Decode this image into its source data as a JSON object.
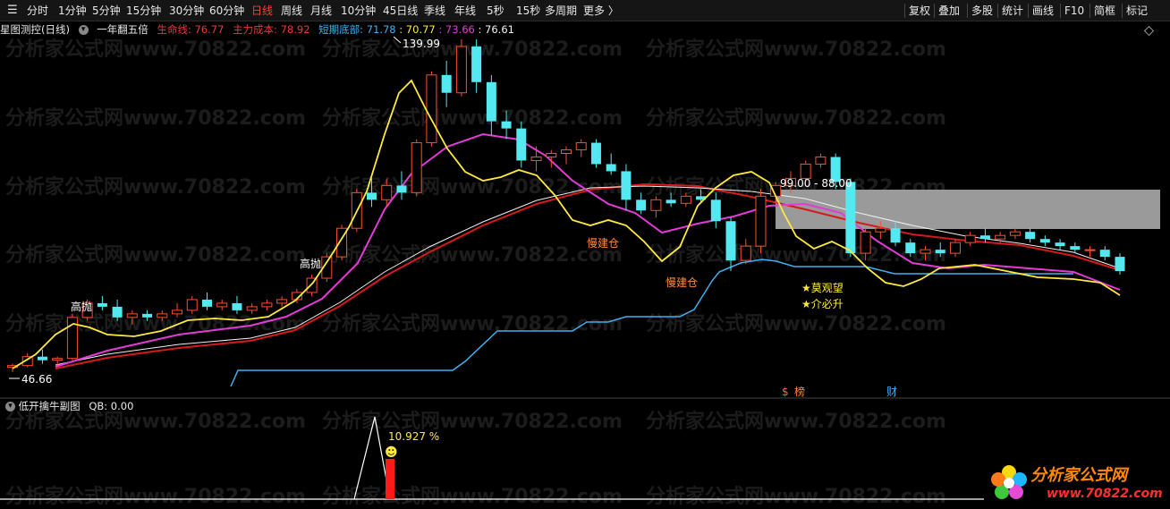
{
  "toolbar": {
    "periods": [
      "分时",
      "1分钟",
      "5分钟",
      "15分钟",
      "30分钟",
      "60分钟",
      "日线",
      "周线",
      "月线",
      "10分钟",
      "45日线",
      "季线",
      "年线",
      "5秒",
      "15秒",
      "多周期",
      "更多 〉"
    ],
    "active_period": "日线",
    "right_tools": [
      "复权",
      "叠加",
      "多股",
      "统计",
      "画线",
      "F10",
      "简框",
      "标记"
    ]
  },
  "legend": {
    "title": "星图测控(日线)",
    "formula": "一年翻五倍",
    "shengming_label": "生命线: 76.77",
    "zhuli_label": "主力成本: 78.92",
    "duanqi_label": "短期底部: 71.78",
    "v1": ": 70.77",
    "v2": ": 73.66",
    "v3": ": 76.61"
  },
  "annotations": {
    "high": "139.99",
    "low": "46.66",
    "range": "99.00 - 88.00",
    "gaopao1": "高抛",
    "gaopao2": "高抛",
    "jiancang1": "慢建仓",
    "jiancang2": "慢建仓",
    "moguanwang": "★莫观望",
    "jiebisheng": "★介必升",
    "tag_s": "$",
    "tag_bang": "榜",
    "tag_cai": "财"
  },
  "sub": {
    "title": "低开擒牛副图",
    "qb": "QB: 0.00",
    "pct": "10.927 %",
    "smiley": "☻"
  },
  "watermark": "分析家公式网www.70822.com",
  "brand": {
    "name": "分析家公式网",
    "url": "www.70822.com"
  },
  "colors": {
    "up": "#ff4d2e",
    "down": "#54e8f0",
    "ma_yellow": "#ffea3c",
    "ma_magenta": "#e33bd6",
    "ma_red": "#d61a1a",
    "ma_white": "#f2f2f2",
    "ma_blue": "#3fb1f0",
    "zone_gray": "#9a9a9a"
  },
  "chart_data": {
    "type": "candlestick",
    "price_range": [
      46.66,
      139.99
    ],
    "candles": [
      [
        48,
        49,
        46.7,
        48.5
      ],
      [
        48.5,
        52,
        48,
        51
      ],
      [
        51,
        53,
        49,
        50
      ],
      [
        50,
        51,
        48.5,
        50.5
      ],
      [
        50.5,
        63,
        50,
        62
      ],
      [
        62,
        67,
        61,
        66
      ],
      [
        66,
        68,
        64,
        65
      ],
      [
        65,
        67,
        61,
        62
      ],
      [
        62,
        64,
        60,
        63
      ],
      [
        63,
        64,
        61,
        62
      ],
      [
        62,
        64,
        61,
        63
      ],
      [
        63,
        66,
        62,
        64
      ],
      [
        64,
        68,
        63,
        67
      ],
      [
        67,
        69,
        64,
        65
      ],
      [
        65,
        67,
        64,
        66
      ],
      [
        66,
        68,
        63,
        64
      ],
      [
        64,
        66,
        63,
        65
      ],
      [
        65,
        67,
        64,
        66
      ],
      [
        66,
        68,
        65,
        67
      ],
      [
        67,
        70,
        66,
        69
      ],
      [
        69,
        74,
        68,
        73
      ],
      [
        73,
        80,
        72,
        79
      ],
      [
        79,
        88,
        78,
        87
      ],
      [
        87,
        98,
        86,
        97
      ],
      [
        97,
        101,
        93,
        95
      ],
      [
        95,
        101,
        93,
        99
      ],
      [
        99,
        103,
        95,
        97
      ],
      [
        97,
        112,
        96,
        111
      ],
      [
        111,
        131,
        110,
        130
      ],
      [
        130,
        134,
        121,
        125
      ],
      [
        125,
        140,
        124,
        138
      ],
      [
        138,
        139.99,
        125,
        128
      ],
      [
        128,
        130,
        113,
        117
      ],
      [
        117,
        120,
        112,
        115
      ],
      [
        115,
        117,
        104,
        106
      ],
      [
        106,
        110,
        103,
        107
      ],
      [
        107,
        109,
        104,
        108
      ],
      [
        108,
        110,
        105,
        109
      ],
      [
        109,
        112,
        107,
        111
      ],
      [
        111,
        112,
        104,
        105
      ],
      [
        105,
        108,
        102,
        103
      ],
      [
        103,
        105,
        92,
        95
      ],
      [
        95,
        97,
        91,
        92
      ],
      [
        92,
        96,
        90,
        95
      ],
      [
        95,
        97,
        93,
        94
      ],
      [
        94,
        97,
        93,
        96
      ],
      [
        96,
        98,
        94,
        95
      ],
      [
        95,
        97,
        87,
        89
      ],
      [
        89,
        90,
        75,
        78
      ],
      [
        78,
        84,
        77,
        82
      ],
      [
        82,
        98,
        80,
        96
      ],
      [
        96,
        100,
        94,
        99
      ],
      [
        99,
        103,
        97,
        101
      ],
      [
        101,
        106,
        100,
        105
      ],
      [
        105,
        108,
        104,
        107
      ],
      [
        107,
        108,
        98,
        100
      ],
      [
        100,
        101,
        79,
        80
      ],
      [
        80,
        87,
        78,
        86
      ],
      [
        86,
        89,
        84,
        87
      ],
      [
        87,
        89,
        82,
        83
      ],
      [
        83,
        84,
        79,
        80
      ],
      [
        80,
        82,
        78,
        81
      ],
      [
        81,
        83,
        79,
        80
      ],
      [
        80,
        84,
        79,
        83
      ],
      [
        83,
        86,
        82,
        85
      ],
      [
        85,
        87,
        83,
        84
      ],
      [
        84,
        86,
        83,
        85
      ],
      [
        85,
        87,
        84,
        86
      ],
      [
        86,
        87,
        83,
        84
      ],
      [
        84,
        85,
        82,
        83
      ],
      [
        83,
        84,
        81,
        82
      ],
      [
        82,
        83,
        80,
        81
      ],
      [
        81,
        82,
        79,
        81
      ],
      [
        81,
        82,
        78,
        79
      ],
      [
        79,
        80,
        74,
        75
      ]
    ]
  }
}
